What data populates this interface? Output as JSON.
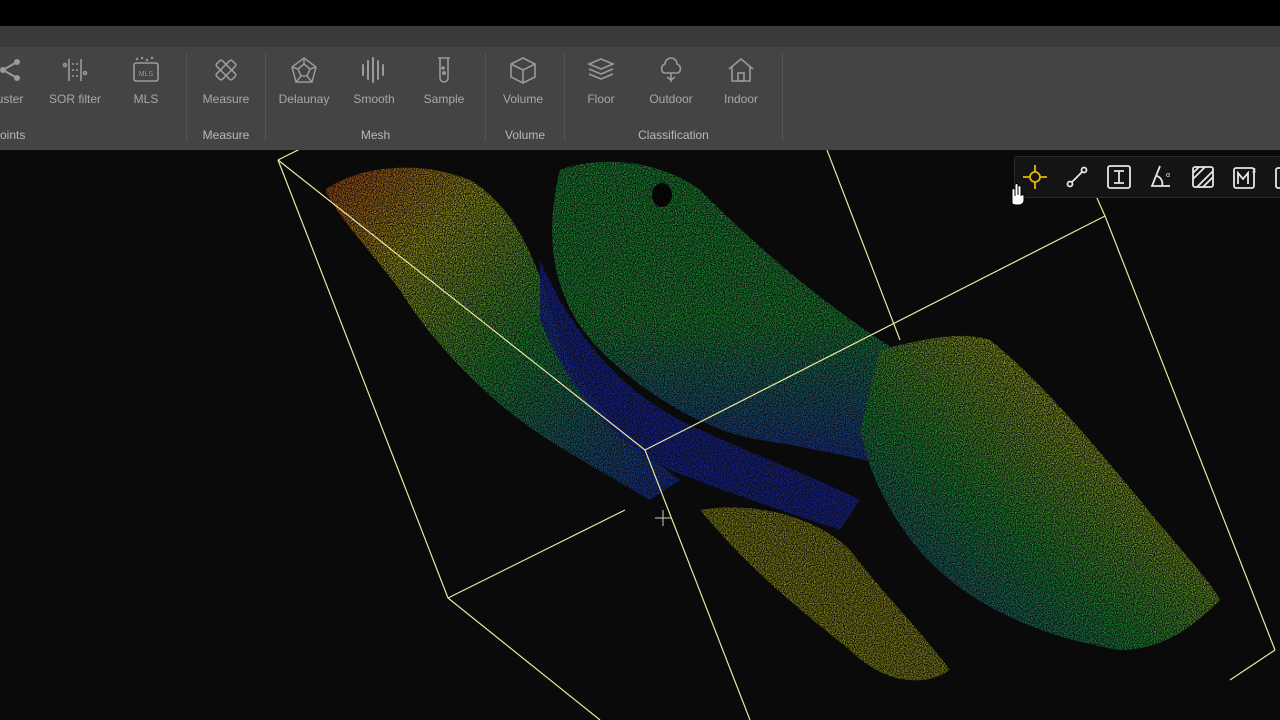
{
  "ribbon": {
    "groups": [
      {
        "label": "oints",
        "tools": [
          {
            "label": "uster",
            "icon": "cluster-icon"
          },
          {
            "label": "SOR filter",
            "icon": "sor-filter-icon"
          },
          {
            "label": "MLS",
            "icon": "mls-icon"
          }
        ]
      },
      {
        "label": "Measure",
        "tools": [
          {
            "label": "Measure",
            "icon": "measure-icon"
          }
        ]
      },
      {
        "label": "Mesh",
        "tools": [
          {
            "label": "Delaunay",
            "icon": "delaunay-icon"
          },
          {
            "label": "Smooth",
            "icon": "smooth-icon"
          },
          {
            "label": "Sample",
            "icon": "sample-icon"
          }
        ]
      },
      {
        "label": "Volume",
        "tools": [
          {
            "label": "Volume",
            "icon": "volume-icon"
          }
        ]
      },
      {
        "label": "Classification",
        "tools": [
          {
            "label": "Floor",
            "icon": "floor-icon"
          },
          {
            "label": "Outdoor",
            "icon": "outdoor-icon"
          },
          {
            "label": "Indoor",
            "icon": "indoor-icon"
          }
        ]
      }
    ]
  },
  "measure_toolbar": {
    "active_color": "#e8b600",
    "buttons": [
      {
        "icon": "point-measure-icon",
        "active": true
      },
      {
        "icon": "distance-measure-icon",
        "active": false
      },
      {
        "icon": "height-measure-icon",
        "active": false
      },
      {
        "icon": "angle-measure-icon",
        "active": false
      },
      {
        "icon": "area-measure-icon",
        "active": false
      },
      {
        "icon": "volume-measure-icon",
        "active": false
      }
    ]
  },
  "viewport": {
    "elevation_colors": [
      "#1a2cc8",
      "#1fa03a",
      "#b4b41e",
      "#d05018"
    ],
    "bounding_box_color": "#e8e8a0"
  }
}
